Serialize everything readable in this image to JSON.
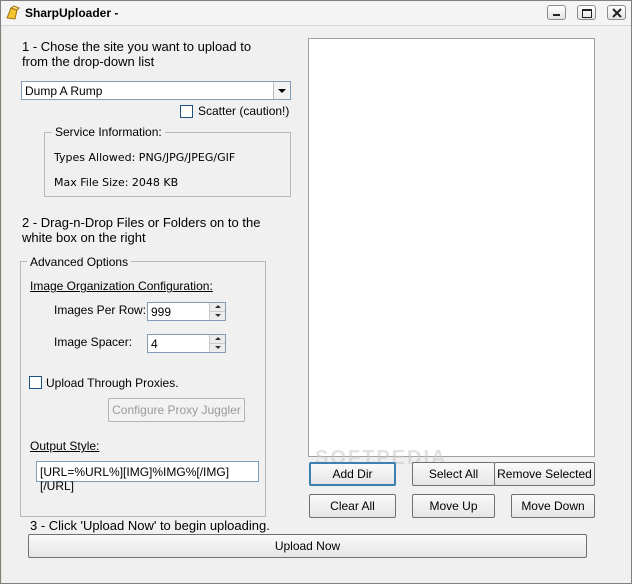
{
  "window": {
    "title": "SharpUploader -",
    "icon": "app-icon"
  },
  "step1": {
    "text_line1": "1 - Chose the site you want to upload to",
    "text_line2": "from the drop-down list",
    "site_select_value": "Dump A Rump",
    "scatter_label": "Scatter (caution!)"
  },
  "service_info": {
    "title": "Service Information:",
    "types_allowed": "Types Allowed: PNG/JPG/JPEG/GIF",
    "max_file_size": "Max File Size: 2048 KB"
  },
  "step2": {
    "text_line1": "2 - Drag-n-Drop Files or Folders on to the",
    "text_line2": "white box on the right"
  },
  "advanced": {
    "title": "Advanced Options",
    "org_config_label": "Image Organization Configuration:",
    "images_per_row_label": "Images Per Row:",
    "images_per_row_value": "999",
    "image_spacer_label": "Image Spacer:",
    "image_spacer_value": "4",
    "proxies_label": "Upload Through Proxies.",
    "configure_proxy_label": "Configure Proxy Juggler",
    "output_style_label": "Output Style:",
    "output_style_value": "[URL=%URL%][IMG]%IMG%[/IMG][/URL]"
  },
  "buttons": {
    "add_dir": "Add Dir",
    "select_all": "Select All",
    "remove_selected": "Remove Selected",
    "clear_all": "Clear All",
    "move_up": "Move Up",
    "move_down": "Move Down",
    "upload_now": "Upload Now"
  },
  "step3": {
    "text": "3 - Click 'Upload Now' to begin uploading."
  },
  "watermark": "SOFTPEDIA"
}
